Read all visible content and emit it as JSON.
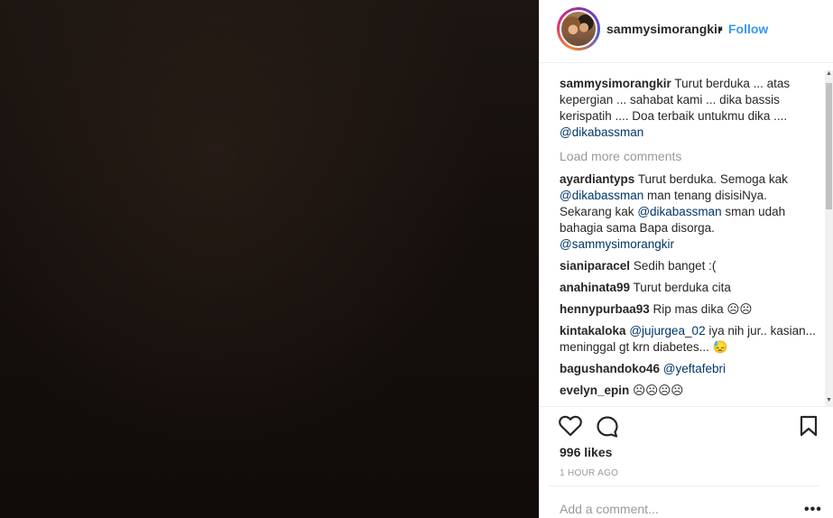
{
  "post": {
    "username": "sammysimorangkir",
    "separator": "•",
    "follow_label": "Follow"
  },
  "caption": {
    "username": "sammysimorangkir",
    "text": "Turut berduka ... atas kepergian ... sahabat kami ... dika bassis kerispatih .... Doa terbaik untukmu dika ....",
    "mention": "@dikabassman"
  },
  "load_more_label": "Load more comments",
  "comments": [
    {
      "username": "ayardiantyps",
      "t1": "Turut berduka. Semoga kak",
      "m1": "@dikabassman",
      "t2": "man tenang disisiNya. Sekarang kak",
      "m2": "@dikabassman",
      "t3": "sman udah bahagia sama Bapa disorga.",
      "m3": "@sammysimorangkir"
    },
    {
      "username": "sianiparacel",
      "text": "Sedih banget :("
    },
    {
      "username": "anahinata99",
      "text": "Turut berduka cita"
    },
    {
      "username": "hennypurbaa93",
      "text": "Rip mas dika ☹☹"
    },
    {
      "username": "kintakaloka",
      "mention": "@jujurgea_02",
      "text": "iya nih jur.. kasian... meninggal gt krn diabetes... 😓"
    },
    {
      "username": "bagushandoko46",
      "mention": "@yeftafebri"
    },
    {
      "username": "evelyn_epin",
      "text": "☹☹☹☹"
    }
  ],
  "icons": {
    "like": "heart-icon",
    "comment": "comment-bubble-icon",
    "save": "bookmark-icon",
    "more": "more-options-icon"
  },
  "likes_label": "996 likes",
  "timestamp": "1 HOUR AGO",
  "add_comment_placeholder": "Add a comment...",
  "more_label": "•••",
  "colors": {
    "follow": "#3897f0",
    "mention": "#003569",
    "muted": "#999999"
  }
}
